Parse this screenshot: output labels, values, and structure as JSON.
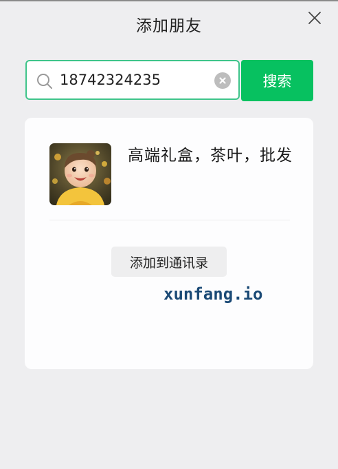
{
  "dialog": {
    "title": "添加朋友",
    "close_icon": "close-icon"
  },
  "search": {
    "value": "18742324235",
    "search_icon": "search-icon",
    "clear_icon": "clear-icon",
    "button_label": "搜索"
  },
  "result": {
    "name": "高端礼盒，茶叶，批发",
    "avatar": "child-photo-avatar",
    "add_button_label": "添加到通讯录"
  },
  "watermark": {
    "text": "xunfang.io"
  },
  "colors": {
    "accent_green": "#07c160",
    "input_border": "#3ec48a",
    "background": "#eeeef0",
    "card": "#fdfdfe",
    "watermark": "#1b4a76"
  }
}
